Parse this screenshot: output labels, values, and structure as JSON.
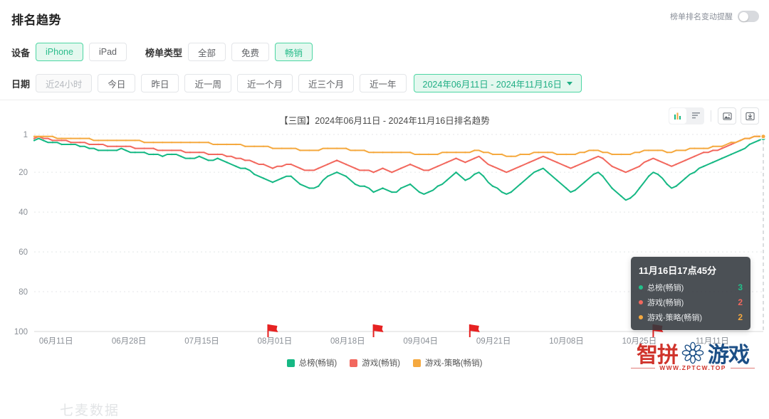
{
  "header": {
    "title": "排名趋势",
    "alert_label": "榜单排名变动提醒",
    "alert_state": "off"
  },
  "filters": {
    "device_label": "设备",
    "device_options": [
      {
        "label": "iPhone",
        "active": true
      },
      {
        "label": "iPad",
        "active": false
      }
    ],
    "list_type_label": "榜单类型",
    "list_type_options": [
      {
        "label": "全部",
        "active": false
      },
      {
        "label": "免费",
        "active": false
      },
      {
        "label": "畅销",
        "active": true
      }
    ],
    "date_label": "日期",
    "date_options": [
      {
        "label": "近24小时",
        "active": false,
        "muted": true
      },
      {
        "label": "今日",
        "active": false
      },
      {
        "label": "昨日",
        "active": false
      },
      {
        "label": "近一周",
        "active": false
      },
      {
        "label": "近一个月",
        "active": false
      },
      {
        "label": "近三个月",
        "active": false
      },
      {
        "label": "近一年",
        "active": false
      }
    ],
    "range_value": "2024年06月11日 - 2024年11月16日"
  },
  "chart_panel": {
    "title": "【三国】2024年06月11日 - 2024年11月16日排名趋势",
    "tools": [
      {
        "name": "bar-chart-icon",
        "active": true
      },
      {
        "name": "list-view-icon",
        "active": false
      },
      {
        "name": "image-export-icon",
        "active": false
      },
      {
        "name": "download-icon",
        "active": false
      }
    ],
    "watermark": "七麦数据"
  },
  "tooltip": {
    "time": "11月16日17点45分",
    "rows": [
      {
        "name": "总榜(畅销)",
        "value": "3",
        "color": "#22c08a"
      },
      {
        "name": "游戏(畅销)",
        "value": "2",
        "color": "#f2685e"
      },
      {
        "name": "游戏-策略(畅销)",
        "value": "2",
        "color": "#f5a93f"
      }
    ]
  },
  "logo": {
    "text_red": "智拼",
    "text_blue": "游戏",
    "url": "WWW.ZPTCW.TOP"
  },
  "chart_data": {
    "type": "line",
    "title": "【三国】2024年06月11日 - 2024年11月16日排名趋势",
    "xlabel": "",
    "ylabel": "",
    "ylim": [
      1,
      100
    ],
    "y_inverted": true,
    "yticks": [
      1,
      20,
      40,
      60,
      80,
      100
    ],
    "grid": true,
    "legend_position": "bottom",
    "xticks": [
      "06月11日",
      "06月28日",
      "07月15日",
      "08月01日",
      "08月18日",
      "09月04日",
      "09月21日",
      "10月08日",
      "10月25日",
      "11月11日"
    ],
    "x_range": [
      "2024-06-11",
      "2024-11-16"
    ],
    "markers": [
      {
        "label": "08月01日",
        "x_index": 51,
        "type": "update-flag",
        "color": "#e62222"
      },
      {
        "label": "08月18日",
        "x_index": 74,
        "type": "update-flag",
        "color": "#e62222"
      },
      {
        "label": "09月10日",
        "x_index": 95,
        "type": "update-flag",
        "color": "#e62222"
      },
      {
        "label": "11月05日",
        "x_index": 135,
        "type": "update-flag",
        "color": "#e62222"
      }
    ],
    "series": [
      {
        "name": "总榜(畅销)",
        "color": "#16b884",
        "values": [
          4,
          3,
          4,
          5,
          5,
          5,
          6,
          6,
          6,
          6,
          7,
          7,
          8,
          8,
          9,
          9,
          9,
          9,
          9,
          8,
          9,
          10,
          10,
          10,
          10,
          11,
          11,
          11,
          12,
          11,
          11,
          11,
          12,
          13,
          13,
          13,
          12,
          13,
          14,
          14,
          13,
          14,
          15,
          16,
          17,
          18,
          18,
          19,
          21,
          22,
          23,
          24,
          25,
          24,
          23,
          22,
          22,
          24,
          26,
          27,
          28,
          28,
          27,
          24,
          22,
          21,
          20,
          21,
          22,
          24,
          26,
          27,
          27,
          28,
          30,
          29,
          28,
          29,
          30,
          30,
          28,
          27,
          26,
          28,
          30,
          31,
          30,
          29,
          27,
          26,
          24,
          22,
          20,
          22,
          24,
          23,
          21,
          20,
          22,
          25,
          27,
          28,
          30,
          31,
          30,
          28,
          26,
          24,
          22,
          20,
          19,
          18,
          20,
          22,
          24,
          26,
          28,
          30,
          29,
          27,
          25,
          23,
          21,
          20,
          22,
          25,
          28,
          30,
          32,
          34,
          33,
          31,
          28,
          25,
          22,
          20,
          21,
          23,
          26,
          28,
          27,
          25,
          23,
          21,
          20,
          18,
          17,
          16,
          15,
          14,
          13,
          12,
          11,
          10,
          9,
          8,
          6,
          5,
          4,
          3
        ]
      },
      {
        "name": "游戏(畅销)",
        "color": "#f2685e",
        "values": [
          3,
          2,
          3,
          3,
          4,
          4,
          4,
          4,
          5,
          5,
          5,
          5,
          6,
          6,
          6,
          6,
          7,
          7,
          7,
          7,
          7,
          7,
          8,
          8,
          8,
          8,
          8,
          9,
          9,
          9,
          9,
          9,
          9,
          10,
          10,
          10,
          10,
          10,
          11,
          11,
          11,
          11,
          12,
          12,
          13,
          13,
          14,
          14,
          15,
          16,
          16,
          17,
          18,
          17,
          17,
          16,
          16,
          17,
          18,
          19,
          19,
          19,
          18,
          17,
          16,
          15,
          14,
          15,
          16,
          17,
          18,
          19,
          19,
          19,
          20,
          19,
          18,
          19,
          20,
          19,
          18,
          17,
          16,
          17,
          18,
          19,
          19,
          18,
          17,
          16,
          15,
          14,
          13,
          14,
          15,
          14,
          13,
          12,
          14,
          16,
          17,
          18,
          19,
          20,
          19,
          18,
          17,
          16,
          15,
          14,
          13,
          12,
          13,
          14,
          15,
          16,
          17,
          18,
          17,
          16,
          15,
          14,
          13,
          12,
          13,
          15,
          17,
          18,
          19,
          20,
          19,
          18,
          17,
          15,
          14,
          13,
          14,
          15,
          16,
          17,
          16,
          15,
          14,
          13,
          12,
          11,
          10,
          10,
          9,
          9,
          8,
          7,
          6,
          5,
          4,
          3,
          3,
          2,
          2,
          2
        ]
      },
      {
        "name": "游戏-策略(畅销)",
        "color": "#f5a93f",
        "values": [
          2,
          2,
          2,
          2,
          2,
          3,
          3,
          3,
          3,
          3,
          3,
          3,
          3,
          4,
          4,
          4,
          4,
          4,
          4,
          4,
          4,
          4,
          4,
          4,
          5,
          5,
          5,
          5,
          5,
          5,
          5,
          5,
          5,
          5,
          5,
          5,
          5,
          5,
          5,
          6,
          6,
          6,
          6,
          6,
          6,
          6,
          7,
          7,
          7,
          7,
          7,
          7,
          8,
          8,
          8,
          8,
          8,
          8,
          9,
          9,
          9,
          9,
          9,
          8,
          8,
          8,
          8,
          8,
          8,
          9,
          9,
          9,
          9,
          10,
          10,
          10,
          10,
          10,
          10,
          10,
          10,
          10,
          10,
          11,
          11,
          11,
          11,
          11,
          11,
          10,
          10,
          10,
          10,
          10,
          10,
          10,
          9,
          9,
          10,
          10,
          11,
          11,
          11,
          12,
          12,
          12,
          11,
          11,
          11,
          10,
          10,
          10,
          10,
          10,
          11,
          11,
          11,
          11,
          11,
          10,
          10,
          9,
          9,
          9,
          10,
          10,
          11,
          11,
          11,
          11,
          11,
          10,
          10,
          9,
          9,
          9,
          9,
          9,
          10,
          10,
          9,
          9,
          9,
          8,
          8,
          8,
          8,
          8,
          7,
          7,
          7,
          6,
          5,
          5,
          4,
          3,
          3,
          2,
          2,
          2
        ]
      }
    ]
  }
}
